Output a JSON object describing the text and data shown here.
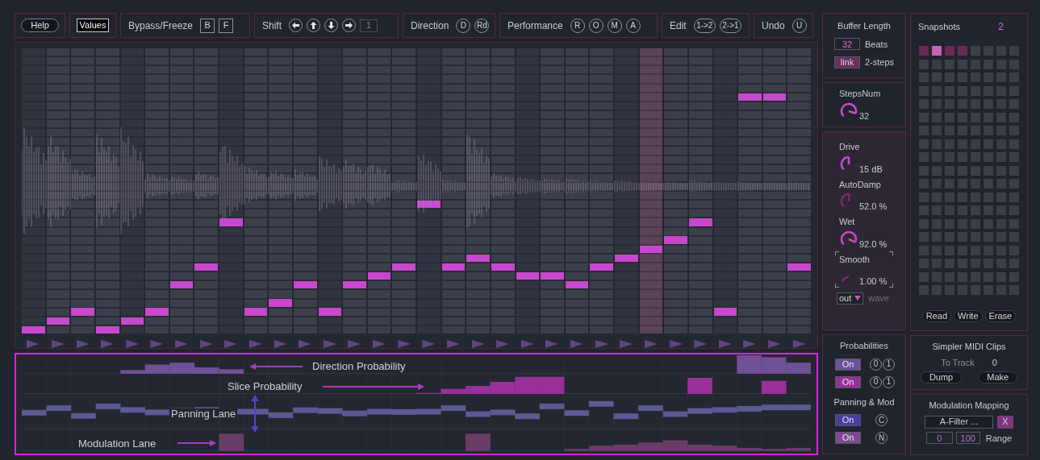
{
  "toolbar": {
    "help_button": "Help",
    "values_button": "Values",
    "bypass_freeze": {
      "label": "Bypass/Freeze",
      "buttons": [
        "B",
        "F"
      ]
    },
    "shift": {
      "label": "Shift",
      "field": "1"
    },
    "direction": {
      "label": "Direction",
      "buttons": [
        "D",
        "Rd"
      ]
    },
    "performance": {
      "label": "Performance",
      "buttons": [
        "R",
        "O",
        "M",
        "A"
      ]
    },
    "edit": {
      "label": "Edit",
      "buttons": [
        "1->2",
        "2->1"
      ]
    },
    "undo": {
      "label": "Undo",
      "buttons": [
        "U"
      ]
    }
  },
  "step_grid": {
    "columns": [
      {
        "level": 0,
        "selected": false
      },
      {
        "level": 0.032,
        "selected": false
      },
      {
        "level": 0.065,
        "selected": false
      },
      {
        "level": 0,
        "selected": false
      },
      {
        "level": 0.032,
        "selected": false
      },
      {
        "level": 0.065,
        "selected": false
      },
      {
        "level": 0.161,
        "selected": false
      },
      {
        "level": 0.226,
        "selected": false
      },
      {
        "level": 0.387,
        "selected": false
      },
      {
        "level": 0.065,
        "selected": false
      },
      {
        "level": 0.097,
        "selected": false
      },
      {
        "level": 0.161,
        "selected": false
      },
      {
        "level": 0.065,
        "selected": false
      },
      {
        "level": 0.161,
        "selected": false
      },
      {
        "level": 0.194,
        "selected": false
      },
      {
        "level": 0.226,
        "selected": false
      },
      {
        "level": 0.452,
        "selected": false
      },
      {
        "level": 0.226,
        "selected": false
      },
      {
        "level": 0.258,
        "selected": false
      },
      {
        "level": 0.226,
        "selected": false
      },
      {
        "level": 0.194,
        "selected": false
      },
      {
        "level": 0.194,
        "selected": false
      },
      {
        "level": 0.161,
        "selected": false
      },
      {
        "level": 0.226,
        "selected": false
      },
      {
        "level": 0.258,
        "selected": false
      },
      {
        "level": 0.29,
        "selected": true
      },
      {
        "level": 0.323,
        "selected": false
      },
      {
        "level": 0.387,
        "selected": false
      },
      {
        "level": 0.065,
        "selected": false
      },
      {
        "level": 0.839,
        "selected": false
      },
      {
        "level": 0.839,
        "selected": false
      },
      {
        "level": 0.226,
        "selected": false
      }
    ]
  },
  "lanes": [
    {
      "kind": "bar",
      "annotation": "Direction Probability",
      "color": "#6e5196"
    },
    {
      "kind": "bar",
      "annotation": "Slice Probability",
      "color": "#9a2f9a"
    },
    {
      "kind": "bipolar",
      "annotation": "Panning Lane",
      "color": "#5a5a94"
    },
    {
      "kind": "bar",
      "annotation": "Modulation Lane",
      "color": "#6a3d66"
    }
  ],
  "buffer_length": {
    "title": "Buffer Length",
    "value": "32",
    "unit": "Beats",
    "link": {
      "label": "link",
      "on": true
    },
    "link_label": "2-steps"
  },
  "steps_num": {
    "title": "StepsNum",
    "value": "32",
    "color": "#c847cf"
  },
  "effects": [
    {
      "label": "Drive",
      "value": "15 dB",
      "color": "#c847cf",
      "focused": false
    },
    {
      "label": "AutoDamp",
      "value": "52.0 %",
      "color": "#7a2a62",
      "focused": false
    },
    {
      "label": "Wet",
      "value": "92.0 %",
      "color": "#c847cf",
      "focused": false
    },
    {
      "label": "Smooth",
      "value": "1.00 %",
      "color": "#7a2a62",
      "focused": true
    }
  ],
  "output": {
    "mode": "out",
    "label": "wave"
  },
  "snapshots": {
    "title": "Snapshots",
    "count": "2",
    "slots": [
      {
        "filled": true,
        "selected": false
      },
      {
        "filled": true,
        "selected": true
      },
      {
        "filled": true,
        "selected": false
      },
      {
        "filled": true,
        "selected": false
      },
      {
        "filled": false,
        "selected": false
      },
      {
        "filled": false,
        "selected": false
      },
      {
        "filled": false,
        "selected": false
      },
      {
        "filled": false,
        "selected": false
      },
      {
        "filled": false,
        "selected": false
      },
      {
        "filled": false,
        "selected": false
      },
      {
        "filled": false,
        "selected": false
      },
      {
        "filled": false,
        "selected": false
      },
      {
        "filled": false,
        "selected": false
      },
      {
        "filled": false,
        "selected": false
      },
      {
        "filled": false,
        "selected": false
      },
      {
        "filled": false,
        "selected": false
      },
      {
        "filled": false,
        "selected": false
      },
      {
        "filled": false,
        "selected": false
      },
      {
        "filled": false,
        "selected": false
      },
      {
        "filled": false,
        "selected": false
      },
      {
        "filled": false,
        "selected": false
      },
      {
        "filled": false,
        "selected": false
      },
      {
        "filled": false,
        "selected": false
      },
      {
        "filled": false,
        "selected": false
      },
      {
        "filled": false,
        "selected": false
      },
      {
        "filled": false,
        "selected": false
      },
      {
        "filled": false,
        "selected": false
      },
      {
        "filled": false,
        "selected": false
      },
      {
        "filled": false,
        "selected": false
      },
      {
        "filled": false,
        "selected": false
      },
      {
        "filled": false,
        "selected": false
      },
      {
        "filled": false,
        "selected": false
      },
      {
        "filled": false,
        "selected": false
      },
      {
        "filled": false,
        "selected": false
      },
      {
        "filled": false,
        "selected": false
      },
      {
        "filled": false,
        "selected": false
      },
      {
        "filled": false,
        "selected": false
      },
      {
        "filled": false,
        "selected": false
      },
      {
        "filled": false,
        "selected": false
      },
      {
        "filled": false,
        "selected": false
      },
      {
        "filled": false,
        "selected": false
      },
      {
        "filled": false,
        "selected": false
      },
      {
        "filled": false,
        "selected": false
      },
      {
        "filled": false,
        "selected": false
      },
      {
        "filled": false,
        "selected": false
      },
      {
        "filled": false,
        "selected": false
      },
      {
        "filled": false,
        "selected": false
      },
      {
        "filled": false,
        "selected": false
      },
      {
        "filled": false,
        "selected": false
      },
      {
        "filled": false,
        "selected": false
      },
      {
        "filled": false,
        "selected": false
      },
      {
        "filled": false,
        "selected": false
      },
      {
        "filled": false,
        "selected": false
      },
      {
        "filled": false,
        "selected": false
      },
      {
        "filled": false,
        "selected": false
      },
      {
        "filled": false,
        "selected": false
      },
      {
        "filled": false,
        "selected": false
      },
      {
        "filled": false,
        "selected": false
      },
      {
        "filled": false,
        "selected": false
      },
      {
        "filled": false,
        "selected": false
      },
      {
        "filled": false,
        "selected": false
      },
      {
        "filled": false,
        "selected": false
      },
      {
        "filled": false,
        "selected": false
      },
      {
        "filled": false,
        "selected": false
      },
      {
        "filled": false,
        "selected": false
      },
      {
        "filled": false,
        "selected": false
      },
      {
        "filled": false,
        "selected": false
      },
      {
        "filled": false,
        "selected": false
      },
      {
        "filled": false,
        "selected": false
      },
      {
        "filled": false,
        "selected": false
      },
      {
        "filled": false,
        "selected": false
      },
      {
        "filled": false,
        "selected": false
      },
      {
        "filled": false,
        "selected": false
      },
      {
        "filled": false,
        "selected": false
      },
      {
        "filled": false,
        "selected": false
      },
      {
        "filled": false,
        "selected": false
      },
      {
        "filled": false,
        "selected": false
      },
      {
        "filled": false,
        "selected": false
      },
      {
        "filled": false,
        "selected": false
      },
      {
        "filled": false,
        "selected": false
      },
      {
        "filled": false,
        "selected": false
      },
      {
        "filled": false,
        "selected": false
      },
      {
        "filled": false,
        "selected": false
      },
      {
        "filled": false,
        "selected": false
      },
      {
        "filled": false,
        "selected": false
      },
      {
        "filled": false,
        "selected": false
      },
      {
        "filled": false,
        "selected": false
      },
      {
        "filled": false,
        "selected": false
      },
      {
        "filled": false,
        "selected": false
      },
      {
        "filled": false,
        "selected": false
      },
      {
        "filled": false,
        "selected": false
      },
      {
        "filled": false,
        "selected": false
      },
      {
        "filled": false,
        "selected": false
      },
      {
        "filled": false,
        "selected": false
      },
      {
        "filled": false,
        "selected": false
      },
      {
        "filled": false,
        "selected": false
      },
      {
        "filled": false,
        "selected": false
      },
      {
        "filled": false,
        "selected": false
      },
      {
        "filled": false,
        "selected": false
      },
      {
        "filled": false,
        "selected": false
      },
      {
        "filled": false,
        "selected": false
      },
      {
        "filled": false,
        "selected": false
      },
      {
        "filled": false,
        "selected": false
      },
      {
        "filled": false,
        "selected": false
      },
      {
        "filled": false,
        "selected": false
      },
      {
        "filled": false,
        "selected": false
      },
      {
        "filled": false,
        "selected": false
      },
      {
        "filled": false,
        "selected": false
      },
      {
        "filled": false,
        "selected": false
      },
      {
        "filled": false,
        "selected": false
      },
      {
        "filled": false,
        "selected": false
      },
      {
        "filled": false,
        "selected": false
      },
      {
        "filled": false,
        "selected": false
      },
      {
        "filled": false,
        "selected": false
      },
      {
        "filled": false,
        "selected": false
      },
      {
        "filled": false,
        "selected": false
      },
      {
        "filled": false,
        "selected": false
      },
      {
        "filled": false,
        "selected": false
      },
      {
        "filled": false,
        "selected": false
      },
      {
        "filled": false,
        "selected": false
      },
      {
        "filled": false,
        "selected": false
      },
      {
        "filled": false,
        "selected": false
      },
      {
        "filled": false,
        "selected": false
      },
      {
        "filled": false,
        "selected": false
      },
      {
        "filled": false,
        "selected": false
      },
      {
        "filled": false,
        "selected": false
      },
      {
        "filled": false,
        "selected": false
      },
      {
        "filled": false,
        "selected": false
      },
      {
        "filled": false,
        "selected": false
      },
      {
        "filled": false,
        "selected": false
      },
      {
        "filled": false,
        "selected": false
      },
      {
        "filled": false,
        "selected": false
      },
      {
        "filled": false,
        "selected": false
      },
      {
        "filled": false,
        "selected": false
      },
      {
        "filled": false,
        "selected": false
      },
      {
        "filled": false,
        "selected": false
      },
      {
        "filled": false,
        "selected": false
      },
      {
        "filled": false,
        "selected": false
      },
      {
        "filled": false,
        "selected": false
      },
      {
        "filled": false,
        "selected": false
      },
      {
        "filled": false,
        "selected": false
      },
      {
        "filled": false,
        "selected": false
      },
      {
        "filled": false,
        "selected": false
      },
      {
        "filled": false,
        "selected": false
      },
      {
        "filled": false,
        "selected": false
      },
      {
        "filled": false,
        "selected": false
      },
      {
        "filled": false,
        "selected": false
      },
      {
        "filled": false,
        "selected": false
      },
      {
        "filled": false,
        "selected": false
      },
      {
        "filled": false,
        "selected": false
      },
      {
        "filled": false,
        "selected": false
      },
      {
        "filled": false,
        "selected": false
      }
    ],
    "buttons": [
      "Read",
      "Write",
      "Erase"
    ]
  },
  "probabilities": {
    "title": "Probabilities",
    "rows": [
      {
        "toggle": "On",
        "on": true,
        "color": "#6e5196",
        "buttons": [
          "0",
          "1"
        ]
      },
      {
        "toggle": "On",
        "on": true,
        "color": "#9a2f9a",
        "buttons": [
          "0",
          "1"
        ]
      }
    ]
  },
  "panning_mod": {
    "title": "Panning & Mod",
    "rows": [
      {
        "toggle": "On",
        "on": true,
        "color": "#4a3fa0",
        "buttons": [
          "C"
        ]
      },
      {
        "toggle": "On",
        "on": true,
        "color": "#7d4a92",
        "buttons": [
          "N"
        ]
      }
    ]
  },
  "simpler_midi_clips": {
    "title": "Simpler MIDI Clips",
    "to_track_label": "To Track",
    "to_track_value": "0",
    "buttons": [
      "Dump",
      "Make"
    ]
  },
  "modulation_mapping": {
    "title": "Modulation Mapping",
    "target": "A-Filter ...",
    "clear_button": "X",
    "range_min": "0",
    "range_max": "100",
    "range_label": "Range"
  }
}
